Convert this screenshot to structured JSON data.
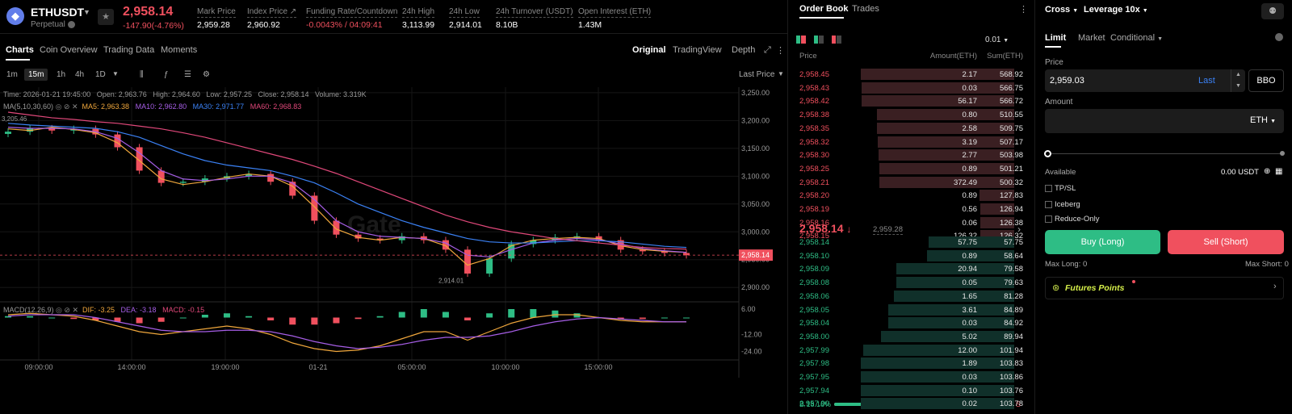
{
  "header": {
    "symbol": "ETHUSDT",
    "contract_type": "Perpetual",
    "last_price": "2,958.14",
    "change": "-147.90(-4.76%)",
    "stats": [
      {
        "label": "Mark Price",
        "value": "2,959.28"
      },
      {
        "label": "Index Price ↗",
        "value": "2,960.92"
      },
      {
        "label": "Funding Rate/Countdown",
        "value": "-0.0043% / 04:09:41"
      },
      {
        "label": "24h High",
        "value": "3,113.99"
      },
      {
        "label": "24h Low",
        "value": "2,914.01"
      },
      {
        "label": "24h Turnover (USDT)",
        "value": "8.10B"
      },
      {
        "label": "Open Interest (ETH)",
        "value": "1.43M"
      }
    ]
  },
  "tabs": {
    "left": [
      "Charts",
      "Coin Overview",
      "Trading Data",
      "Moments"
    ],
    "right": [
      "Original",
      "TradingView",
      "Depth"
    ]
  },
  "toolbar": {
    "intervals": [
      "1m",
      "15m",
      "1h",
      "4h",
      "1D"
    ],
    "selected_interval": "15m",
    "last_price_label": "Last Price"
  },
  "chart_info": {
    "time": "Time: 2026-01-21 19:45:00",
    "open": "Open: 2,963.76",
    "high": "High: 2,964.60",
    "low": "Low: 2,957.25",
    "close": "Close: 2,958.14",
    "volume": "Volume: 3.319K",
    "ma_label": "MA(5,10,30,60)",
    "ma5": "MA5: 2,963.38",
    "ma10": "MA10: 2,962.80",
    "ma30": "MA30: 2,971.77",
    "ma60": "MA60: 2,968.83",
    "macd_label": "MACD(12,26,9)",
    "dif": "DIF: -3.25",
    "dea": "DEA: -3.18",
    "macd": "MACD: -0.15",
    "high_marker": "3,205.46",
    "low_marker": "2,914.01",
    "price_tag": "2,958.14",
    "watermark": "Gate"
  },
  "chart_data": {
    "type": "line",
    "title": "",
    "x_tick_labels": [
      "09:00:00",
      "14:00:00",
      "19:00:00",
      "01-21",
      "05:00:00",
      "10:00:00",
      "15:00:00"
    ],
    "y_tick_labels": [
      "3,250.00",
      "3,200.00",
      "3,150.00",
      "3,100.00",
      "3,050.00",
      "3,000.00",
      "2,950.00",
      "2,900.00"
    ],
    "ylim": [
      2880,
      3260
    ],
    "macd_tick_labels": [
      "6.00",
      "-12.00",
      "-24.00"
    ],
    "macd_ylim": [
      -30,
      10
    ],
    "series": [
      {
        "name": "MA5",
        "color": "#f0a73c",
        "values": [
          3185,
          3182,
          3188,
          3184,
          3178,
          3160,
          3128,
          3095,
          3085,
          3090,
          3098,
          3104,
          3100,
          3082,
          3045,
          3005,
          2990,
          2985,
          2990,
          2988,
          2975,
          2940,
          2952,
          2975,
          2985,
          2988,
          2990,
          2988,
          2975,
          2968,
          2965,
          2963
        ]
      },
      {
        "name": "MA10",
        "color": "#a65ee6",
        "values": [
          3188,
          3186,
          3186,
          3185,
          3180,
          3168,
          3142,
          3110,
          3095,
          3092,
          3095,
          3100,
          3100,
          3088,
          3058,
          3020,
          3000,
          2992,
          2990,
          2988,
          2980,
          2958,
          2955,
          2968,
          2980,
          2985,
          2988,
          2986,
          2978,
          2970,
          2966,
          2963
        ]
      },
      {
        "name": "MA30",
        "color": "#3b82f6",
        "values": [
          3195,
          3192,
          3190,
          3188,
          3186,
          3180,
          3170,
          3155,
          3140,
          3128,
          3120,
          3115,
          3110,
          3100,
          3088,
          3070,
          3050,
          3035,
          3020,
          3008,
          2998,
          2988,
          2982,
          2980,
          2980,
          2982,
          2984,
          2984,
          2982,
          2978,
          2974,
          2972
        ]
      },
      {
        "name": "MA60",
        "color": "#e0487a",
        "values": [
          3215,
          3210,
          3205,
          3202,
          3198,
          3195,
          3190,
          3185,
          3178,
          3170,
          3160,
          3150,
          3140,
          3130,
          3118,
          3105,
          3090,
          3075,
          3060,
          3045,
          3030,
          3018,
          3008,
          3000,
          2994,
          2988,
          2984,
          2980,
          2976,
          2972,
          2970,
          2969
        ]
      }
    ],
    "price": {
      "close": [
        3180,
        3186,
        3182,
        3185,
        3175,
        3152,
        3110,
        3088,
        3090,
        3096,
        3100,
        3104,
        3090,
        3065,
        3020,
        2995,
        2988,
        2985,
        2992,
        2985,
        2968,
        2925,
        2952,
        2978,
        2985,
        2990,
        2992,
        2985,
        2968,
        2965,
        2962,
        2958
      ],
      "grid": true
    },
    "macd": {
      "dif": [
        2,
        3,
        2,
        1,
        -2,
        -6,
        -10,
        -12,
        -10,
        -8,
        -6,
        -8,
        -12,
        -18,
        -22,
        -24,
        -23,
        -20,
        -15,
        -10,
        -10,
        -16,
        -10,
        -4,
        0,
        2,
        2,
        0,
        -2,
        -3,
        -3,
        -3
      ],
      "dea": [
        1,
        2,
        2,
        2,
        0,
        -3,
        -6,
        -9,
        -10,
        -10,
        -9,
        -9,
        -10,
        -13,
        -17,
        -20,
        -22,
        -21,
        -19,
        -16,
        -14,
        -14,
        -13,
        -10,
        -6,
        -3,
        -1,
        0,
        -1,
        -2,
        -3,
        -3
      ],
      "hist": [
        1,
        1,
        0,
        -1,
        -2,
        -3,
        -4,
        -3,
        0,
        2,
        3,
        1,
        -2,
        -5,
        -5,
        -4,
        -1,
        1,
        4,
        6,
        4,
        -2,
        3,
        6,
        6,
        5,
        3,
        0,
        -1,
        -1,
        0,
        0
      ]
    }
  },
  "orderbook": {
    "tabs": [
      "Order Book",
      "Trades"
    ],
    "precision": "0.01",
    "columns": [
      "Price",
      "Amount(ETH)",
      "Sum(ETH)"
    ],
    "asks": [
      {
        "price": "2,958.45",
        "amount": "2.17",
        "sum": "568.92",
        "depth": 1.0
      },
      {
        "price": "2,958.43",
        "amount": "0.03",
        "sum": "566.75",
        "depth": 0.996
      },
      {
        "price": "2,958.42",
        "amount": "56.17",
        "sum": "566.72",
        "depth": 0.996
      },
      {
        "price": "2,958.38",
        "amount": "0.80",
        "sum": "510.55",
        "depth": 0.897
      },
      {
        "price": "2,958.35",
        "amount": "2.58",
        "sum": "509.75",
        "depth": 0.896
      },
      {
        "price": "2,958.32",
        "amount": "3.19",
        "sum": "507.17",
        "depth": 0.891
      },
      {
        "price": "2,958.30",
        "amount": "2.77",
        "sum": "503.98",
        "depth": 0.886
      },
      {
        "price": "2,958.25",
        "amount": "0.89",
        "sum": "501.21",
        "depth": 0.881
      },
      {
        "price": "2,958.21",
        "amount": "372.49",
        "sum": "500.32",
        "depth": 0.879
      },
      {
        "price": "2,958.20",
        "amount": "0.89",
        "sum": "127.83",
        "depth": 0.225
      },
      {
        "price": "2,958.19",
        "amount": "0.56",
        "sum": "126.94",
        "depth": 0.223
      },
      {
        "price": "2,958.16",
        "amount": "0.06",
        "sum": "126.38",
        "depth": 0.222
      },
      {
        "price": "2,958.15",
        "amount": "126.32",
        "sum": "126.32",
        "depth": 0.222
      }
    ],
    "mid_price": "2,958.14",
    "mid_arrow": "↓",
    "mark_price": "2,959.28",
    "bids": [
      {
        "price": "2,958.14",
        "amount": "57.75",
        "sum": "57.75",
        "depth": 0.557
      },
      {
        "price": "2,958.10",
        "amount": "0.89",
        "sum": "58.64",
        "depth": 0.566
      },
      {
        "price": "2,958.09",
        "amount": "20.94",
        "sum": "79.58",
        "depth": 0.767
      },
      {
        "price": "2,958.08",
        "amount": "0.05",
        "sum": "79.63",
        "depth": 0.768
      },
      {
        "price": "2,958.06",
        "amount": "1.65",
        "sum": "81.28",
        "depth": 0.784
      },
      {
        "price": "2,958.05",
        "amount": "3.61",
        "sum": "84.89",
        "depth": 0.819
      },
      {
        "price": "2,958.04",
        "amount": "0.03",
        "sum": "84.92",
        "depth": 0.819
      },
      {
        "price": "2,958.00",
        "amount": "5.02",
        "sum": "89.94",
        "depth": 0.867
      },
      {
        "price": "2,957.99",
        "amount": "12.00",
        "sum": "101.94",
        "depth": 0.983
      },
      {
        "price": "2,957.98",
        "amount": "1.89",
        "sum": "103.83",
        "depth": 1.0
      },
      {
        "price": "2,957.95",
        "amount": "0.03",
        "sum": "103.86",
        "depth": 1.0
      },
      {
        "price": "2,957.94",
        "amount": "0.10",
        "sum": "103.76",
        "depth": 1.0
      },
      {
        "price": "2,957.90",
        "amount": "0.02",
        "sum": "103.78",
        "depth": 1.0
      }
    ],
    "buy_ratio": "B 18.16%",
    "sell_ratio": "81.84% S",
    "buy_fraction": 0.1816
  },
  "trade": {
    "margin_mode": "Cross",
    "leverage": "Leverage 10x",
    "order_types": [
      "Limit",
      "Market",
      "Conditional"
    ],
    "price_label": "Price",
    "price_value": "2,959.03",
    "last_label": "Last",
    "bbo_label": "BBO",
    "amount_label": "Amount",
    "amount_unit": "ETH",
    "available_label": "Available",
    "available_value": "0.00 USDT",
    "options": [
      "TP/SL",
      "Iceberg",
      "Reduce-Only"
    ],
    "buy_label": "Buy (Long)",
    "sell_label": "Sell (Short)",
    "max_long": "Max Long: 0",
    "max_short": "Max Short: 0",
    "futures_points": "Futures Points",
    "colors": {
      "buy": "#2ebd85",
      "sell": "#f0505e"
    }
  }
}
